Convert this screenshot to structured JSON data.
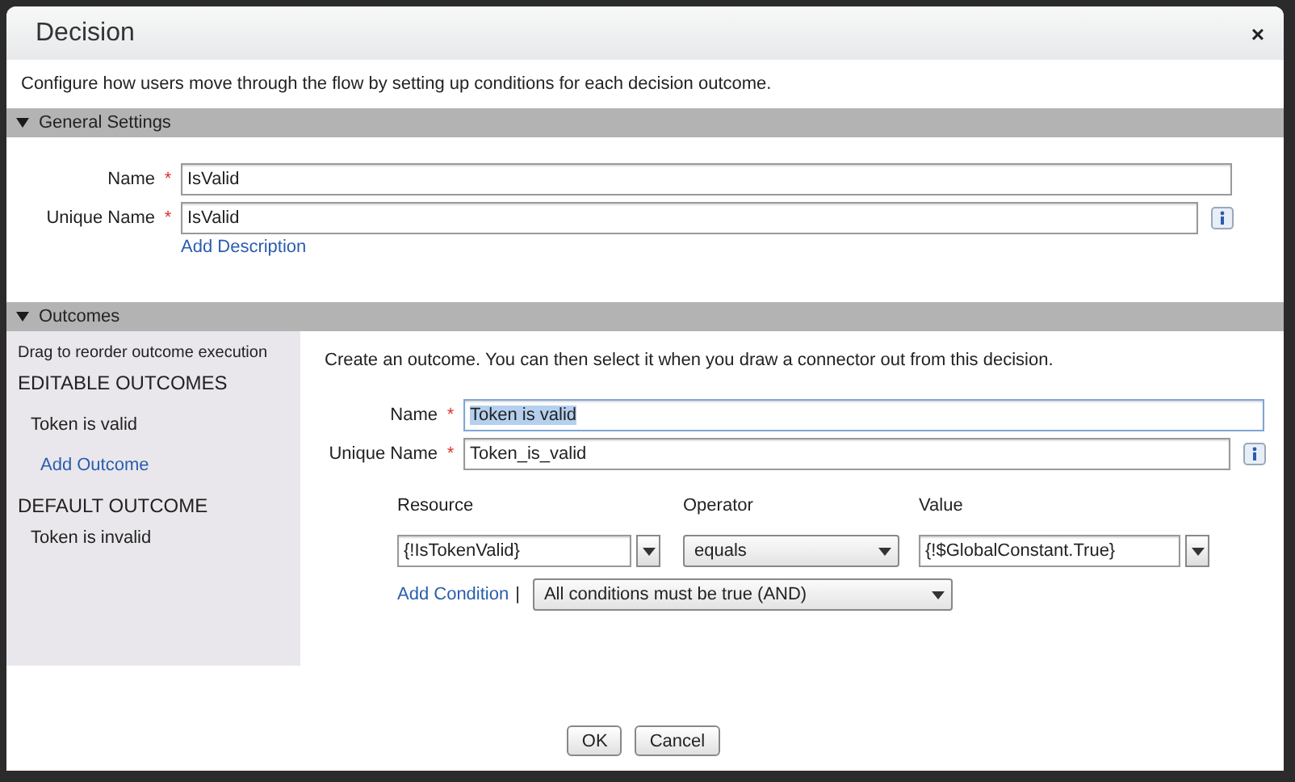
{
  "dialog": {
    "title": "Decision",
    "close": "×",
    "description": "Configure how users move through the flow by setting up conditions for each decision outcome."
  },
  "general_settings": {
    "title": "General Settings",
    "expanded": true,
    "fields": [
      {
        "label": "Name",
        "required_mark": "*",
        "value": "IsValid",
        "info": false,
        "text_selected": false
      },
      {
        "label": "Unique Name",
        "required_mark": "*",
        "value": "IsValid",
        "info": true,
        "text_selected": false
      }
    ],
    "link": "Add Description"
  },
  "outcomes": {
    "title": "Outcomes",
    "expanded": true,
    "sidebar": {
      "hint": "Drag to reorder outcome execution",
      "editable_heading": "EDITABLE OUTCOMES",
      "editable_items": [
        "Token is valid"
      ],
      "add_link": "Add Outcome",
      "default_heading": "DEFAULT OUTCOME",
      "default_items": [
        "Token is invalid"
      ]
    },
    "intro": "Create an outcome.  You can then select it when you draw a connector out from this decision.",
    "fields": [
      {
        "label": "Name",
        "required_mark": "*",
        "value": "Token is valid",
        "info": false,
        "text_selected": true
      },
      {
        "label": "Unique Name",
        "required_mark": "*",
        "value": "Token_is_valid",
        "info": true,
        "text_selected": false
      }
    ],
    "columns": [
      "Resource",
      "Operator",
      "Value"
    ],
    "conditions": [
      {
        "resource": "{!IsTokenValid}",
        "operator": "equals",
        "value": "{!$GlobalConstant.True}"
      }
    ],
    "add_condition": "Add Condition",
    "separator": "|",
    "logic": "All conditions must be true (AND)"
  },
  "buttons": [
    "OK",
    "Cancel"
  ]
}
